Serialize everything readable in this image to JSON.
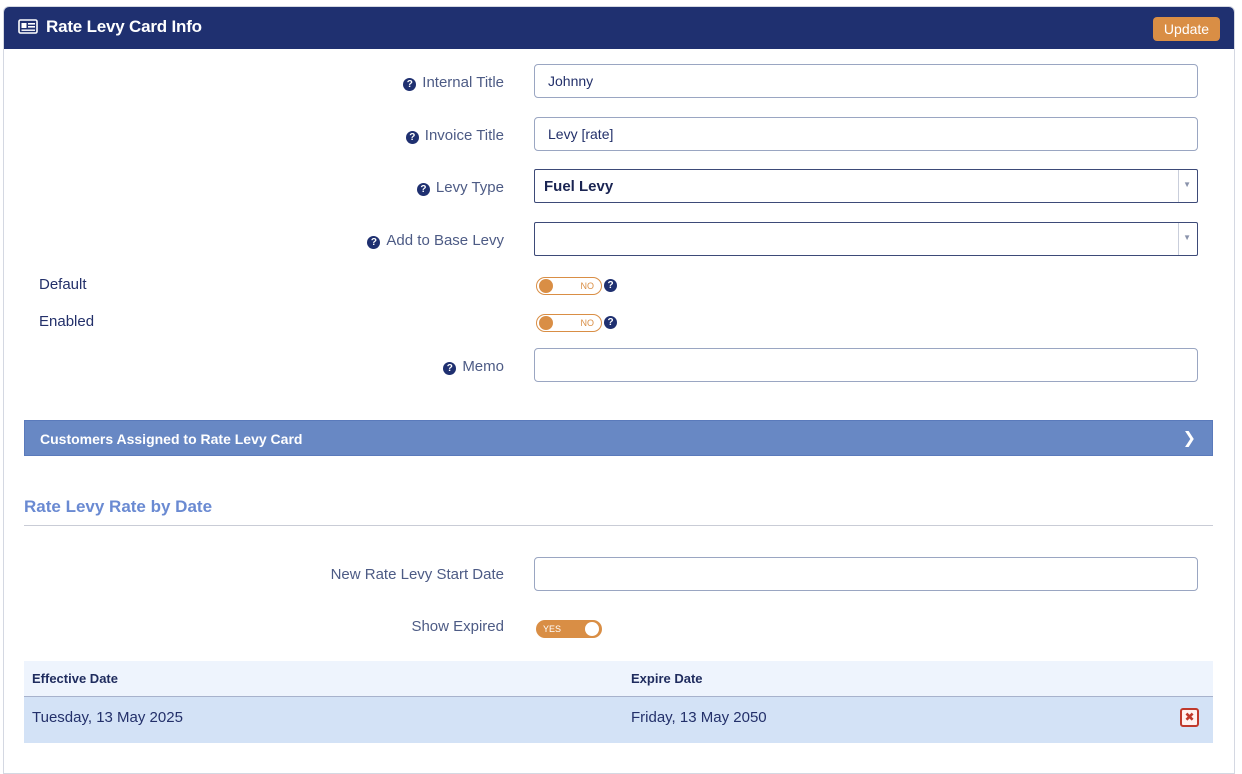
{
  "header": {
    "title": "Rate Levy Card Info",
    "icon": "id-card-icon",
    "update_label": "Update",
    "colors": {
      "bar": "#1f3070",
      "accent": "#d98e45"
    }
  },
  "form": {
    "internal_title": {
      "label": "Internal Title",
      "value": "Johnny"
    },
    "invoice_title": {
      "label": "Invoice Title",
      "value": "Levy [rate]"
    },
    "levy_type": {
      "label": "Levy Type",
      "value": "Fuel Levy"
    },
    "add_to_base_levy": {
      "label": "Add to Base Levy",
      "value": ""
    },
    "default": {
      "label": "Default",
      "state": "NO"
    },
    "enabled": {
      "label": "Enabled",
      "state": "NO"
    },
    "memo": {
      "label": "Memo",
      "value": ""
    }
  },
  "customers_section": {
    "title": "Customers Assigned to Rate Levy Card"
  },
  "rates_section": {
    "title": "Rate Levy Rate by Date",
    "new_start_date": {
      "label": "New Rate Levy Start Date",
      "value": ""
    },
    "show_expired": {
      "label": "Show Expired",
      "state": "YES"
    },
    "table": {
      "columns": [
        "Effective Date",
        "Expire Date"
      ],
      "rows": [
        {
          "effective": "Tuesday, 13 May 2025",
          "expire": "Friday, 13 May 2050"
        }
      ]
    }
  }
}
